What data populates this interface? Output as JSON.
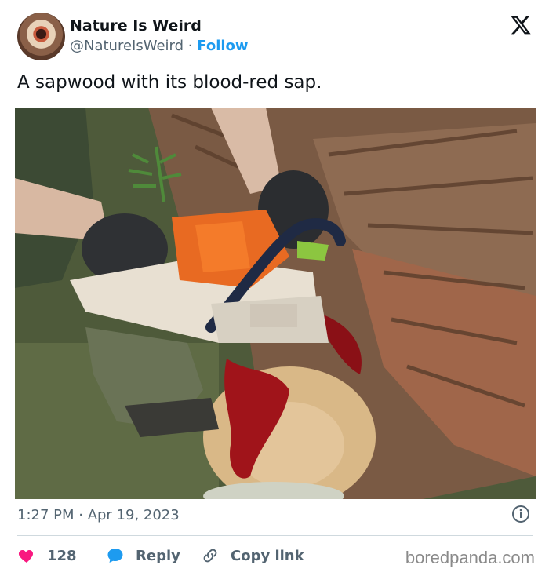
{
  "author": {
    "name": "Nature Is Weird",
    "handle": "@NatureIsWeird",
    "separator": "·",
    "follow_label": "Follow"
  },
  "tweet": {
    "text": "A sapwood with its blood-red sap.",
    "timestamp": "1:27 PM · Apr 19, 2023"
  },
  "actions": {
    "like_count": "128",
    "reply_label": "Reply",
    "copy_link_label": "Copy link"
  },
  "watermark": "boredpanda.com",
  "colors": {
    "accent": "#1d9bf0",
    "like": "#f91880",
    "text_secondary": "#536471"
  },
  "icons": {
    "brand": "x-logo-icon",
    "info": "info-icon",
    "like": "heart-icon",
    "reply": "reply-bubble-icon",
    "copy": "link-icon"
  }
}
